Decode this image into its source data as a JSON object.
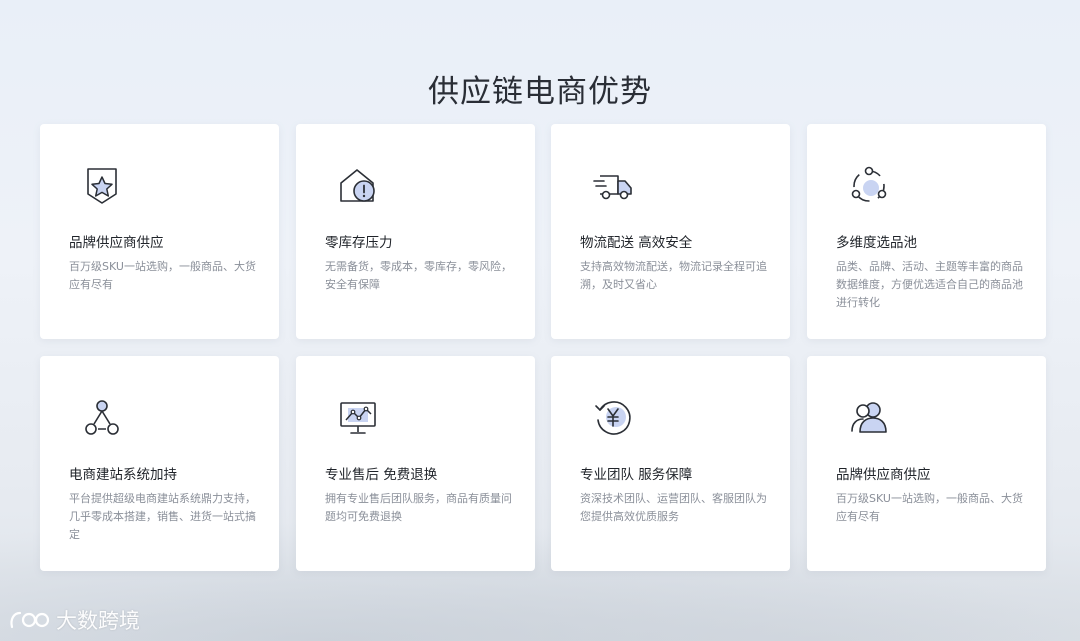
{
  "page": {
    "title": "供应链电商优势"
  },
  "cards": [
    {
      "icon": "star-badge-icon",
      "title": "品牌供应商供应",
      "desc": "百万级SKU一站选购，一般商品、大货应有尽有"
    },
    {
      "icon": "warehouse-alert-icon",
      "title": "零库存压力",
      "desc": "无需备货，零成本，零库存，零风险，安全有保障"
    },
    {
      "icon": "delivery-truck-icon",
      "title": "物流配送 高效安全",
      "desc": "支持高效物流配送，物流记录全程可追溯，及时又省心"
    },
    {
      "icon": "cycle-nodes-icon",
      "title": "多维度选品池",
      "desc": "品类、品牌、活动、主题等丰富的商品数据维度，方便优选适合自己的商品池进行转化"
    },
    {
      "icon": "network-triangle-icon",
      "title": "电商建站系统加持",
      "desc": "平台提供超级电商建站系统鼎力支持，几乎零成本搭建，销售、进货一站式搞定"
    },
    {
      "icon": "monitor-chart-icon",
      "title": "专业售后 免费退换",
      "desc": "拥有专业售后团队服务，商品有质量问题均可免费退换"
    },
    {
      "icon": "yen-refresh-icon",
      "title": "专业团队 服务保障",
      "desc": "资深技术团队、运营团队、客服团队为您提供高效优质服务"
    },
    {
      "icon": "team-users-icon",
      "title": "品牌供应商供应",
      "desc": "百万级SKU一站选购，一般商品、大货应有尽有"
    }
  ],
  "watermark": {
    "text": "大数跨境",
    "logo_text": "100"
  },
  "colors": {
    "icon_stroke": "#2b2f36",
    "icon_accent": "#c9d4f2"
  }
}
